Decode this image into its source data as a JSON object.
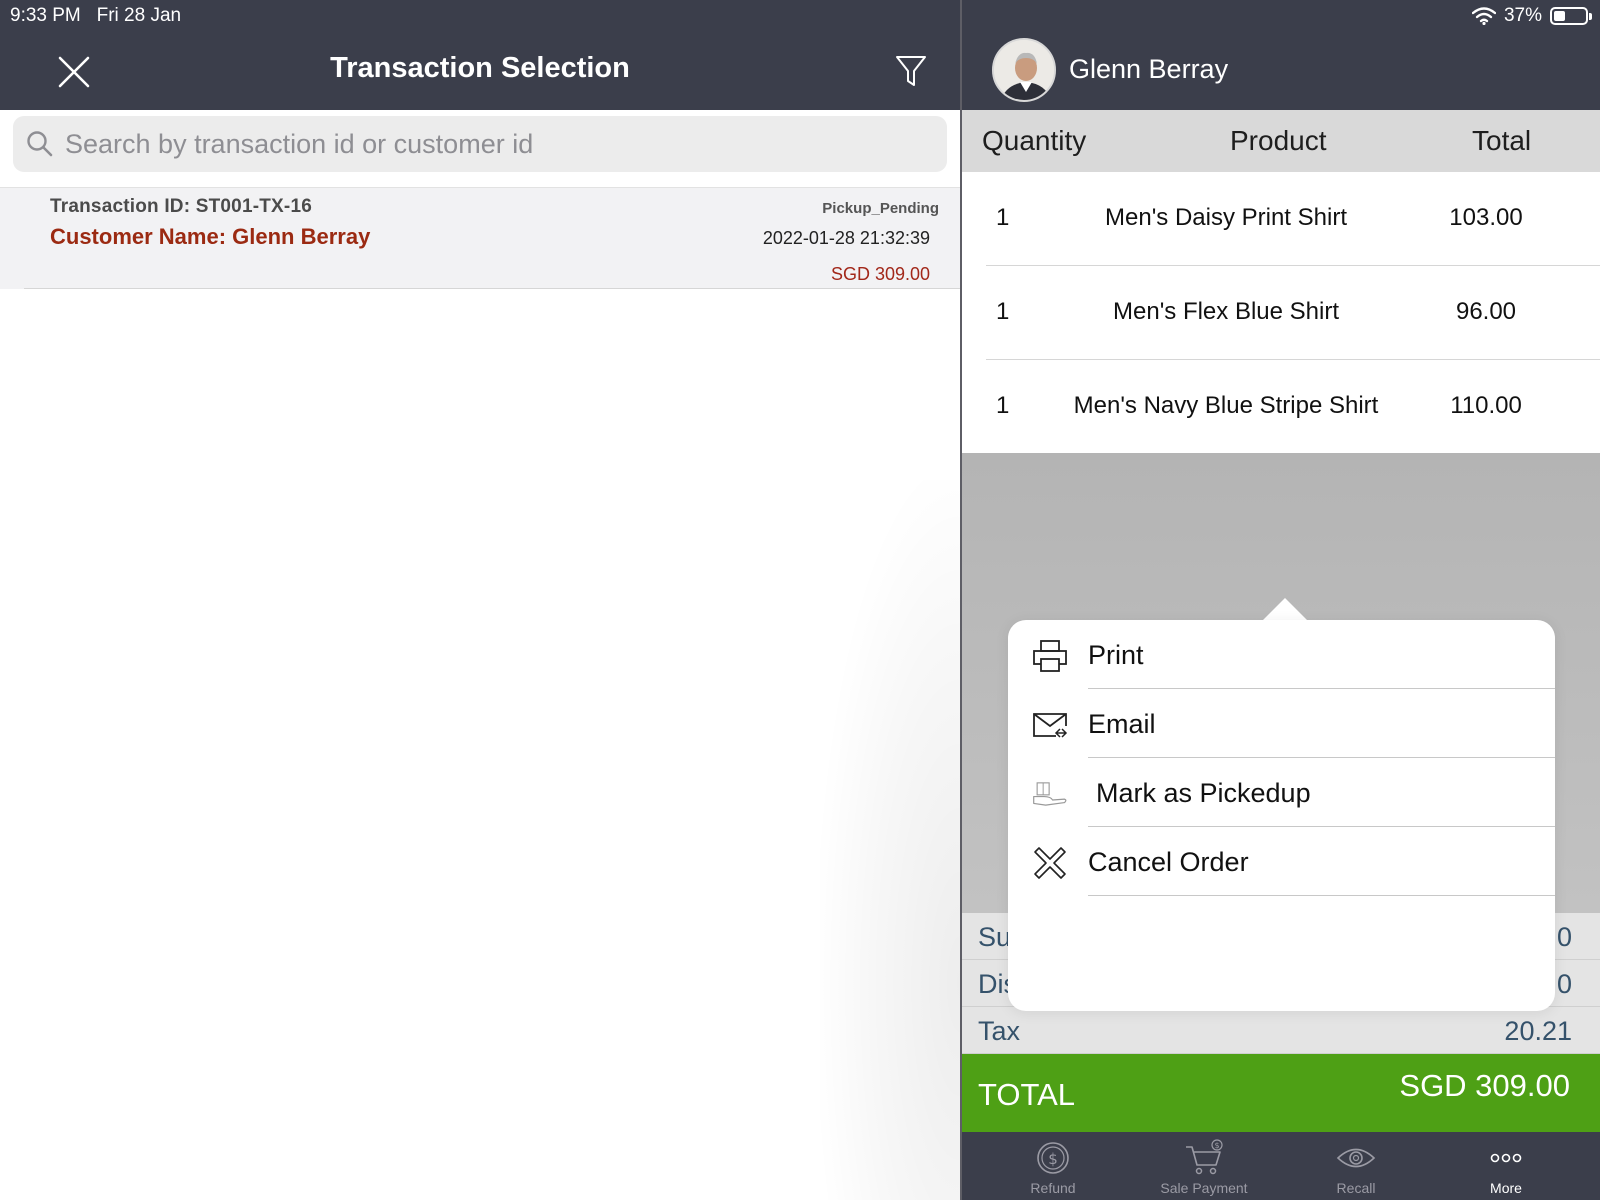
{
  "status_bar": {
    "time": "9:33 PM",
    "date": "Fri 28 Jan",
    "battery": "37%",
    "battery_level": 0.37
  },
  "left_pane": {
    "title": "Transaction Selection",
    "search": {
      "placeholder": "Search by transaction id or customer id",
      "value": ""
    },
    "transactions": [
      {
        "id_label": "Transaction ID: ST001-TX-16",
        "customer_label": "Customer Name: Glenn Berray",
        "status": "Pickup_Pending",
        "datetime": "2022-01-28 21:32:39",
        "amount": "SGD 309.00"
      }
    ]
  },
  "right_pane": {
    "customer_name": "Glenn Berray",
    "columns": {
      "quantity": "Quantity",
      "product": "Product",
      "total": "Total"
    },
    "items": [
      {
        "qty": "1",
        "product": "Men's Daisy Print Shirt",
        "total": "103.00"
      },
      {
        "qty": "1",
        "product": "Men's Flex Blue Shirt",
        "total": "96.00"
      },
      {
        "qty": "1",
        "product": "Men's Navy Blue Stripe Shirt",
        "total": "110.00"
      }
    ],
    "summary": [
      {
        "label": "Su",
        "value": "0"
      },
      {
        "label": "Dis",
        "value": "0"
      },
      {
        "label": "Tax",
        "value": "20.21"
      }
    ],
    "total": {
      "label": "TOTAL",
      "value": "SGD 309.00"
    },
    "tabs": [
      {
        "label": "Refund",
        "icon": "refund-icon"
      },
      {
        "label": "Sale Payment",
        "icon": "cart-icon"
      },
      {
        "label": "Recall",
        "icon": "eye-icon"
      },
      {
        "label": "More",
        "icon": "more-icon"
      }
    ]
  },
  "popover": {
    "items": [
      {
        "label": "Print",
        "icon": "printer-icon"
      },
      {
        "label": "Email",
        "icon": "email-icon"
      },
      {
        "label": "Mark as Pickedup",
        "icon": "pickup-hand-icon"
      },
      {
        "label": "Cancel Order",
        "icon": "cancel-x-icon"
      }
    ]
  },
  "colors": {
    "header_bg": "#3b3e4b",
    "customer_red": "#9b2a12",
    "total_green": "#4ea015",
    "summary_text": "#35526b"
  }
}
